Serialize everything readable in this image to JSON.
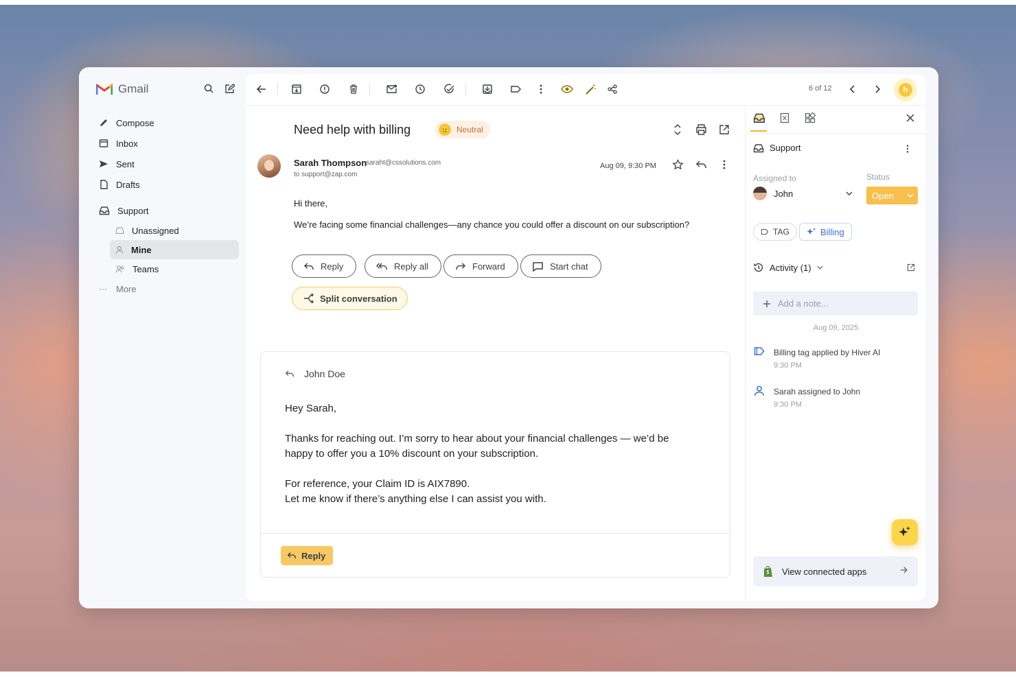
{
  "app": {
    "name": "Gmail"
  },
  "sidebar": {
    "items": [
      {
        "label": "Compose",
        "icon": "pencil-icon"
      },
      {
        "label": "Inbox",
        "icon": "inbox-icon"
      },
      {
        "label": "Sent",
        "icon": "send-icon"
      },
      {
        "label": "Drafts",
        "icon": "draft-icon"
      }
    ],
    "shared_inbox": {
      "label": "Support",
      "icon": "shared-inbox-icon"
    },
    "sub_items": [
      {
        "label": "Unassigned",
        "icon": "inbox-icon"
      },
      {
        "label": "Mine",
        "icon": "person-icon",
        "active": true
      },
      {
        "label": "Teams",
        "icon": "people-icon"
      }
    ],
    "more_label": "More"
  },
  "toolbar": {
    "pager": "6 of 12"
  },
  "email": {
    "subject": "Need help with billing",
    "sentiment": "Neutral",
    "sender_name": "Sarah Thompson",
    "sender_email": "saraht@cssolutions.com",
    "to": "to support@zap.com",
    "date": "Aug 09, 9:30 PM",
    "greeting": "Hi there,",
    "body": "We’re facing some financial challenges—any chance you could offer a discount on our subscription?",
    "actions": {
      "reply": "Reply",
      "reply_all": "Reply all",
      "forward": "Forward",
      "start_chat": "Start chat",
      "split": "Split conversation"
    }
  },
  "reply_draft": {
    "author": "John Doe",
    "greeting": "Hey Sarah,",
    "line1": "Thanks for reaching out. I’m sorry to hear about your financial challenges — we’d be",
    "line2": "happy to offer you a 10% discount on your subscription.",
    "line3": "For reference, your Claim ID is AIX7890.",
    "line4": "Let me know if there’s anything else I can assist you with.",
    "reply_button": "Reply"
  },
  "right_panel": {
    "inbox": "Support",
    "assigned_label": "Assigned to",
    "assignee": "John",
    "status_label": "Status",
    "status": "Open",
    "tag_button": "TAG",
    "tag": "Billing",
    "activity_label": "Activity (1)",
    "note_placeholder": "Add a note...",
    "date": "Aug 09, 2025",
    "activities": [
      {
        "text": "Billing tag applied by Hiver AI",
        "time": "9:30 PM"
      },
      {
        "text": "Sarah assigned to John",
        "time": "9:30 PM"
      }
    ],
    "apps_button": "View connected apps"
  },
  "colors": {
    "accent_yellow": "#f8c865",
    "status_orange": "#f8bf4d",
    "billing_blue": "#3b6fd6",
    "sentiment_text": "#c5703b"
  }
}
